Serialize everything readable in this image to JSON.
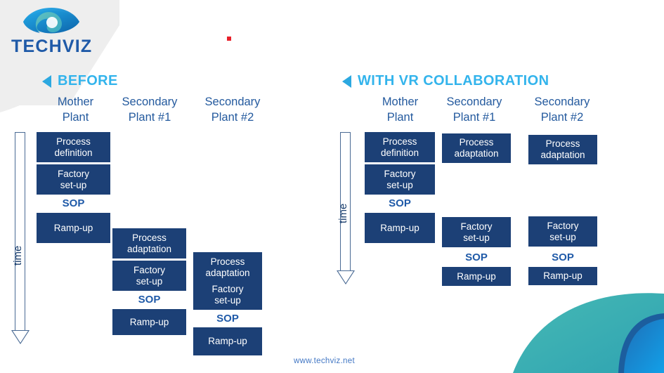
{
  "brand": {
    "name": "TECHVIZ",
    "logo_icon": "eye-swirl-icon",
    "logo_color_teal": "#4FB6B2",
    "logo_color_blue": "#0E86D4",
    "text_color": "#1F5AA8"
  },
  "footer": {
    "url": "www.techviz.net"
  },
  "marker": {
    "red_square_color": "#e8202a"
  },
  "panels": [
    {
      "id": "before",
      "title": "BEFORE",
      "title_color": "#33B4EC",
      "time_label": "time",
      "columns": [
        {
          "header": "Mother\nPlant",
          "blocks": [
            {
              "label": "Process\ndefinition",
              "type": "box"
            },
            {
              "label": "Factory\nset-up",
              "type": "box"
            },
            {
              "label": "SOP",
              "type": "milestone"
            },
            {
              "label": "Ramp-up",
              "type": "box"
            }
          ]
        },
        {
          "header": "Secondary\nPlant #1",
          "blocks": [
            {
              "label": "Process\nadaptation",
              "type": "box"
            },
            {
              "label": "Factory\nset-up",
              "type": "box"
            },
            {
              "label": "SOP",
              "type": "milestone"
            },
            {
              "label": "Ramp-up",
              "type": "box"
            }
          ]
        },
        {
          "header": "Secondary\nPlant #2",
          "blocks": [
            {
              "label": "Process\nadaptation",
              "type": "box"
            },
            {
              "label": "Factory\nset-up",
              "type": "box"
            },
            {
              "label": "SOP",
              "type": "milestone"
            },
            {
              "label": "Ramp-up",
              "type": "box"
            }
          ]
        }
      ]
    },
    {
      "id": "with-vr",
      "title": "WITH VR COLLABORATION",
      "title_color": "#33B4EC",
      "time_label": "time",
      "columns": [
        {
          "header": "Mother\nPlant",
          "blocks": [
            {
              "label": "Process\ndefinition",
              "type": "box"
            },
            {
              "label": "Factory\nset-up",
              "type": "box"
            },
            {
              "label": "SOP",
              "type": "milestone"
            },
            {
              "label": "Ramp-up",
              "type": "box"
            }
          ]
        },
        {
          "header": "Secondary\nPlant #1",
          "blocks": [
            {
              "label": "Process\nadaptation",
              "type": "box"
            },
            {
              "label": "Factory\nset-up",
              "type": "box"
            },
            {
              "label": "SOP",
              "type": "milestone"
            },
            {
              "label": "Ramp-up",
              "type": "box"
            }
          ]
        },
        {
          "header": "Secondary\nPlant #2",
          "blocks": [
            {
              "label": "Process\nadaptation",
              "type": "box"
            },
            {
              "label": "Factory\nset-up",
              "type": "box"
            },
            {
              "label": "SOP",
              "type": "milestone"
            },
            {
              "label": "Ramp-up",
              "type": "box"
            }
          ]
        }
      ]
    }
  ],
  "theme": {
    "box_fill": "#1C4076",
    "box_text": "#FFFFFF",
    "sop_color": "#1F5AA8",
    "header_color": "#245A9E",
    "axis_color": "#4A6A94",
    "band_grey": "#EEEEEE",
    "deco_teal": "#3CB4B4",
    "deco_blue": "#0E86D4"
  }
}
